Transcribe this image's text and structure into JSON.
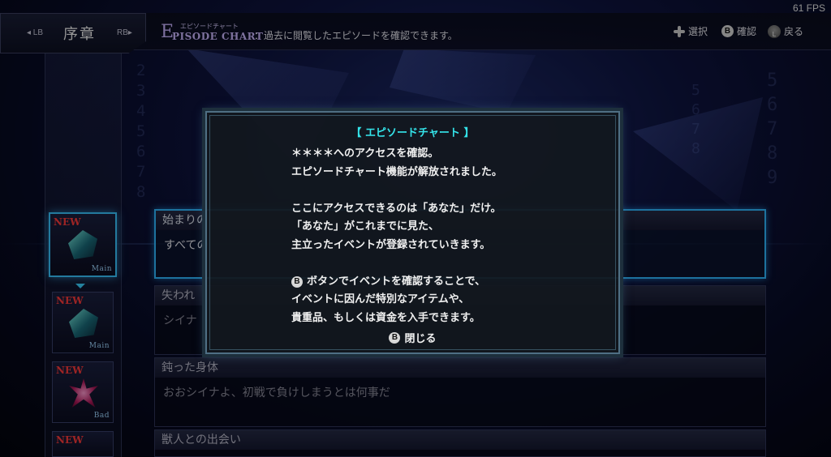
{
  "fps": "61 FPS",
  "topbar": {
    "lb": "◂ LB",
    "chapter": "序章",
    "rb": "RB▸",
    "episode_big_letter": "E",
    "episode_ruby": "エピソードチャート",
    "episode_title": "PISODE CHART",
    "episode_desc": "：過去に閲覧したエピソードを確認できます。",
    "hints": [
      {
        "icon": "dpad-icon",
        "label": "選択"
      },
      {
        "icon": "b-button-icon",
        "glyph": "B",
        "label": "確認"
      },
      {
        "icon": "l-stick-icon",
        "glyph": "L",
        "label": "戻る"
      }
    ]
  },
  "sidebar": {
    "tiles": [
      {
        "new": "NEW",
        "type": "Main",
        "gem": "teal"
      },
      {
        "new": "NEW",
        "type": "Main",
        "gem": "teal"
      },
      {
        "new": "NEW",
        "type": "Bad",
        "gem": "red"
      },
      {
        "new": "NEW",
        "type": "",
        "gem": "teal"
      }
    ]
  },
  "episodes": [
    {
      "title": "始まりの",
      "body": "すべての"
    },
    {
      "title": "失われ",
      "body": "シイナ"
    },
    {
      "title": "鈍った身体",
      "body": "おおシイナよ、初戦で負けしまうとは何事だ"
    },
    {
      "title": "獣人との出会い",
      "body": ""
    }
  ],
  "dialog": {
    "title": "【 エピソードチャート 】",
    "lines": [
      "＊＊＊＊へのアクセスを確認。",
      "エピソードチャート機能が解放されました。",
      "",
      "ここにアクセスできるのは「あなた」だけ。",
      "「あなた」がこれまでに見た、",
      "主立ったイベントが登録されていきます。",
      "",
      "ボタンでイベントを確認することで、",
      "イベントに因んだ特別なアイテムや、",
      "貴重品、もしくは資金を入手できます。"
    ],
    "b_glyph": "B",
    "close_label": "閉じる"
  },
  "colors": {
    "accent": "#34e4ea",
    "selection": "#2fb8ff",
    "new_badge": "#ff3b3b"
  }
}
